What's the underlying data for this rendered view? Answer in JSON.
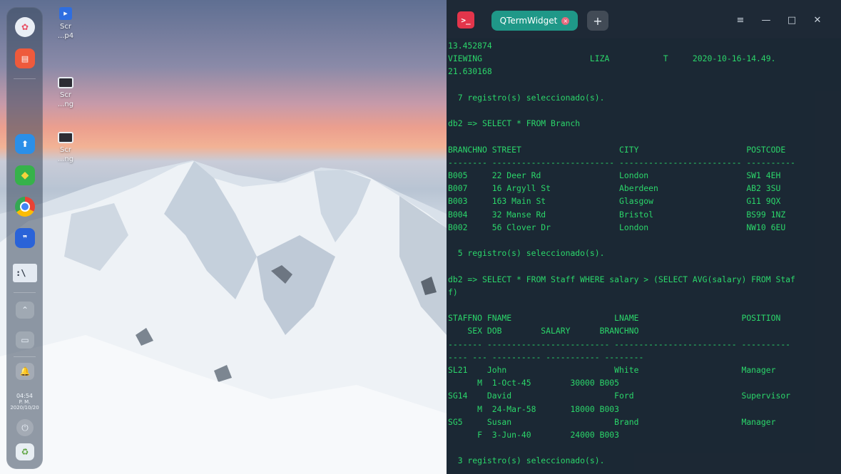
{
  "dock": {
    "items": [
      {
        "name": "launcher-icon",
        "color": "#e9eef5"
      },
      {
        "name": "multitask-icon",
        "color": "#ee5a3c"
      },
      {
        "name": "app-store-icon",
        "color": "#2b8fe8"
      },
      {
        "name": "cube-app-icon",
        "color": "#36b24a"
      },
      {
        "name": "chrome-icon",
        "color": "#e94235"
      },
      {
        "name": "messaging-app-icon",
        "color": "#2a63d8"
      },
      {
        "name": "terminal-app-icon",
        "color": "#e4eaf2"
      }
    ],
    "clock": {
      "time": "04:54",
      "ampm": "P. M.",
      "date": "2020/10/20"
    }
  },
  "desktop_icons": [
    {
      "name": "mp4-file-icon",
      "line1": "Scr",
      "line2": "...p4",
      "color": "#2f6ee0"
    },
    {
      "name": "png-file-icon-1",
      "line1": "Scr",
      "line2": "...ng",
      "color": "#2c2c34"
    },
    {
      "name": "png-file-icon-2",
      "line1": "Scr",
      "line2": "...ng",
      "color": "#2c2c34"
    }
  ],
  "terminal": {
    "app_icon_text": ">_",
    "tab_title": "QTermWidget",
    "add_tab": "+",
    "menu_icon": "≡",
    "minimize_icon": "—",
    "maximize_icon": "□",
    "close_icon": "✕",
    "lines": [
      "13.452874",
      "VIEWING                      LIZA           T     2020-10-16-14.49.",
      "21.630168",
      "",
      "  7 registro(s) seleccionado(s).",
      "",
      "db2 => SELECT * FROM Branch",
      "",
      "BRANCHNO STREET                    CITY                      POSTCODE",
      "-------- ------------------------- ------------------------- ----------",
      "B005     22 Deer Rd                London                    SW1 4EH",
      "B007     16 Argyll St              Aberdeen                  AB2 3SU",
      "B003     163 Main St               Glasgow                   G11 9QX",
      "B004     32 Manse Rd               Bristol                   BS99 1NZ",
      "B002     56 Clover Dr              London                    NW10 6EU",
      "",
      "  5 registro(s) seleccionado(s).",
      "",
      "db2 => SELECT * FROM Staff WHERE salary > (SELECT AVG(salary) FROM Staf",
      "f)",
      "",
      "STAFFNO FNAME                     LNAME                     POSITION",
      "    SEX DOB        SALARY      BRANCHNO",
      "------- ------------------------- ------------------------- ----------",
      "---- --- ---------- ----------- --------",
      "SL21    John                      White                     Manager",
      "      M  1-Oct-45        30000 B005",
      "SG14    David                     Ford                      Supervisor",
      "      M  24-Mar-58       18000 B003",
      "SG5     Susan                     Brand                     Manager",
      "      F  3-Jun-40        24000 B003",
      "",
      "  3 registro(s) seleccionado(s)."
    ]
  }
}
